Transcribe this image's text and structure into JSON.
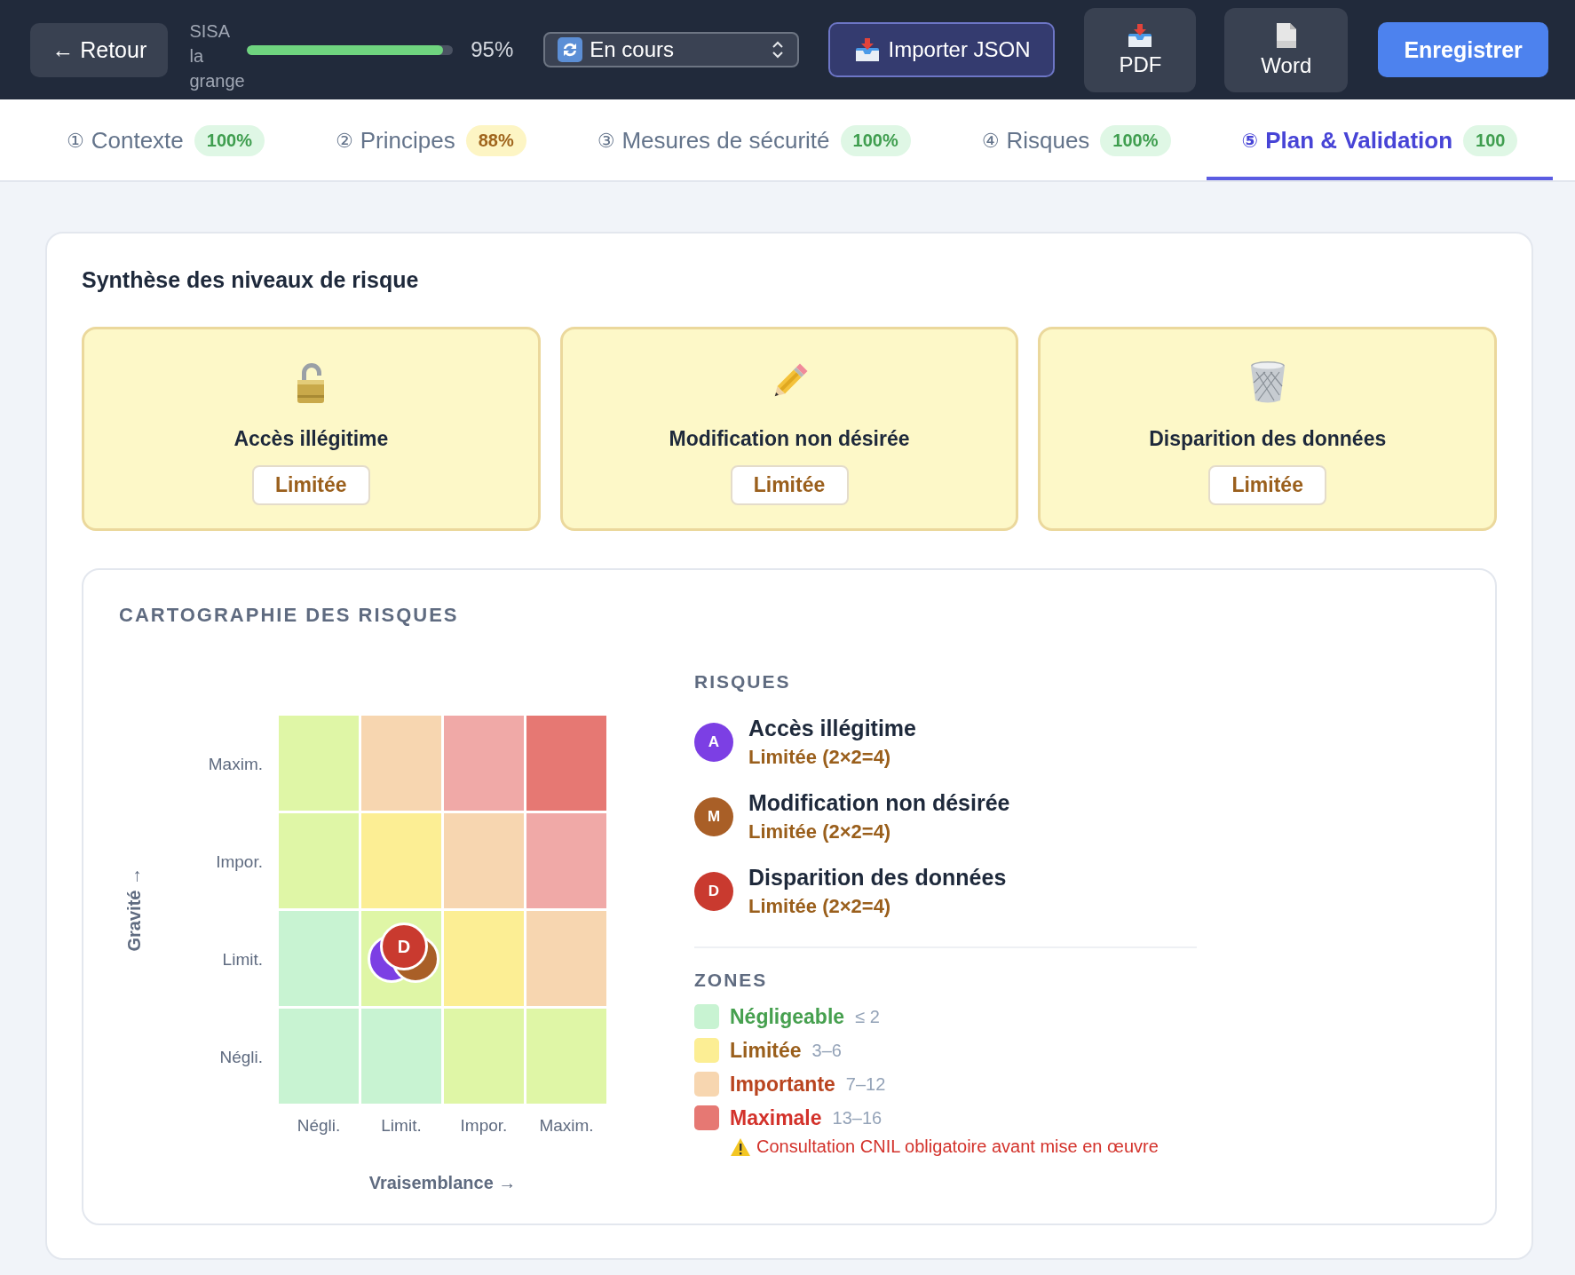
{
  "top_bar": {
    "back_button": "← Retour",
    "project_name": "SISA la grange",
    "progress": {
      "level": 0.95,
      "label": "95%"
    },
    "status_select": {
      "value": "En cours"
    },
    "import_button": "Importer JSON",
    "export_buttons": [
      {
        "kind": "pdf",
        "label": "PDF"
      },
      {
        "kind": "word",
        "label": "Word"
      }
    ],
    "save_button": "Enregistrer"
  },
  "tabs": [
    {
      "number": "①",
      "label": "Contexte",
      "badge": "100%",
      "kind": "complete",
      "selected": false
    },
    {
      "number": "②",
      "label": "Principes",
      "badge": "88%",
      "kind": "partial",
      "selected": false
    },
    {
      "number": "③",
      "label": "Mesures de sécurité",
      "badge": "100%",
      "kind": "complete",
      "selected": false
    },
    {
      "number": "④",
      "label": "Risques",
      "badge": "100%",
      "kind": "complete",
      "selected": false
    },
    {
      "number": "⑤",
      "label": "Plan & Validation",
      "badge": "100",
      "kind": "complete",
      "selected": true
    }
  ],
  "summary": {
    "title": "Synthèse des niveaux de risque",
    "cards": [
      {
        "kind": "lock",
        "title": "Accès illégitime",
        "rating": "Limitée"
      },
      {
        "kind": "pencil",
        "title": "Modification non désirée",
        "rating": "Limitée"
      },
      {
        "kind": "trash",
        "title": "Disparition des données",
        "rating": "Limitée"
      }
    ]
  },
  "risk_map": {
    "title": "CARTOGRAPHIE DES RISQUES",
    "y_axis": "Gravité →",
    "x_axis": "Vraisemblance →",
    "column_labels": [
      "Négli.",
      "Limit.",
      "Impor.",
      "Maxim."
    ],
    "rows": [
      {
        "label": "Maxim.",
        "cells": [
          {
            "color": "#dff6a6"
          },
          {
            "color": "#f7d6b0"
          },
          {
            "color": "#f0a9a7"
          },
          {
            "color": "#e67873"
          }
        ]
      },
      {
        "label": "Impor.",
        "cells": [
          {
            "color": "#dff6a6"
          },
          {
            "color": "#fcee94"
          },
          {
            "color": "#f7d6b0"
          },
          {
            "color": "#f0a9a7"
          }
        ]
      },
      {
        "label": "Limit.",
        "cells": [
          {
            "color": "#c8f3d2"
          },
          {
            "color": "#dff6a6",
            "markers": [
              {
                "color": "#7c3fe4"
              },
              {
                "color": "#a95f27"
              },
              {
                "letter": "D",
                "color": "#c93a2f"
              }
            ]
          },
          {
            "color": "#fcee94"
          },
          {
            "color": "#f7d6b0"
          }
        ]
      },
      {
        "label": "Négli.",
        "cells": [
          {
            "color": "#c8f3d2"
          },
          {
            "color": "#c8f3d2"
          },
          {
            "color": "#dff6a6"
          },
          {
            "color": "#dff6a6"
          }
        ]
      }
    ],
    "risks_title": "RISQUES",
    "risks": [
      {
        "letter": "A",
        "name": "Accès illégitime",
        "score": "Limitée (2×2=4)",
        "color": "#7c3fe4"
      },
      {
        "letter": "M",
        "name": "Modification non désirée",
        "score": "Limitée (2×2=4)",
        "color": "#a95f27"
      },
      {
        "letter": "D",
        "name": "Disparition des données",
        "score": "Limitée (2×2=4)",
        "color": "#c93a2f"
      }
    ],
    "zones_title": "ZONES",
    "zones": [
      {
        "kind": "negligible",
        "label": "Négligeable",
        "range": "≤ 2",
        "color": "#c8f3d2"
      },
      {
        "kind": "limited",
        "label": "Limitée",
        "range": "3–6",
        "color": "#fcee94"
      },
      {
        "kind": "important",
        "label": "Importante",
        "range": "7–12",
        "color": "#f7d6b0"
      },
      {
        "kind": "maximal",
        "label": "Maximale",
        "range": "13–16",
        "color": "#e67873"
      }
    ],
    "warning": "Consultation CNIL obligatoire avant mise en œuvre"
  }
}
